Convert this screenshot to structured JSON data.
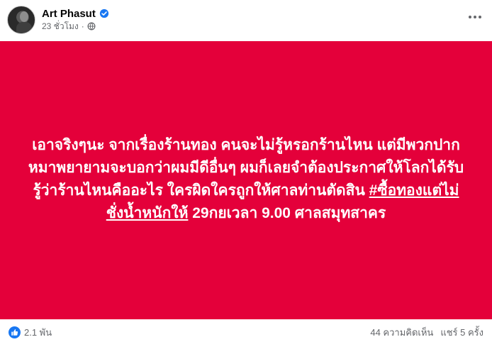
{
  "header": {
    "author": "Art Phasut",
    "time": "23 ชั่วโมง",
    "separator": "·",
    "icons": [
      "verified-badge-icon",
      "globe-icon",
      "more-options-icon"
    ],
    "accent_color": "#1877f2"
  },
  "post": {
    "background_color": "#e4003a",
    "text_before": "เอาจริงๆนะ จากเรื่องร้านทอง คนจะไม่รู้หรอกร้านไหน แต่มีพวกปากหมาพยายามจะบอกว่าผมมีดีอื่นๆ ผมก็เลยจำต้องประกาศให้โลกได้รับรู้ว่าร้านไหนคืออะไร ใครผิดใครถูกให้ศาลท่านตัดสิน ",
    "hashtag": "#ซื้อทองแต่ไม่ชั่งน้ำหนักให้",
    "text_after": " 29กยเวลา 9.00 ศาลสมุทสาคร"
  },
  "footer": {
    "reaction_count": "2.1 พัน",
    "comments": "44 ความคิดเห็น",
    "shares": "แชร์ 5 ครั้ง",
    "reaction_icon": "like-icon"
  }
}
